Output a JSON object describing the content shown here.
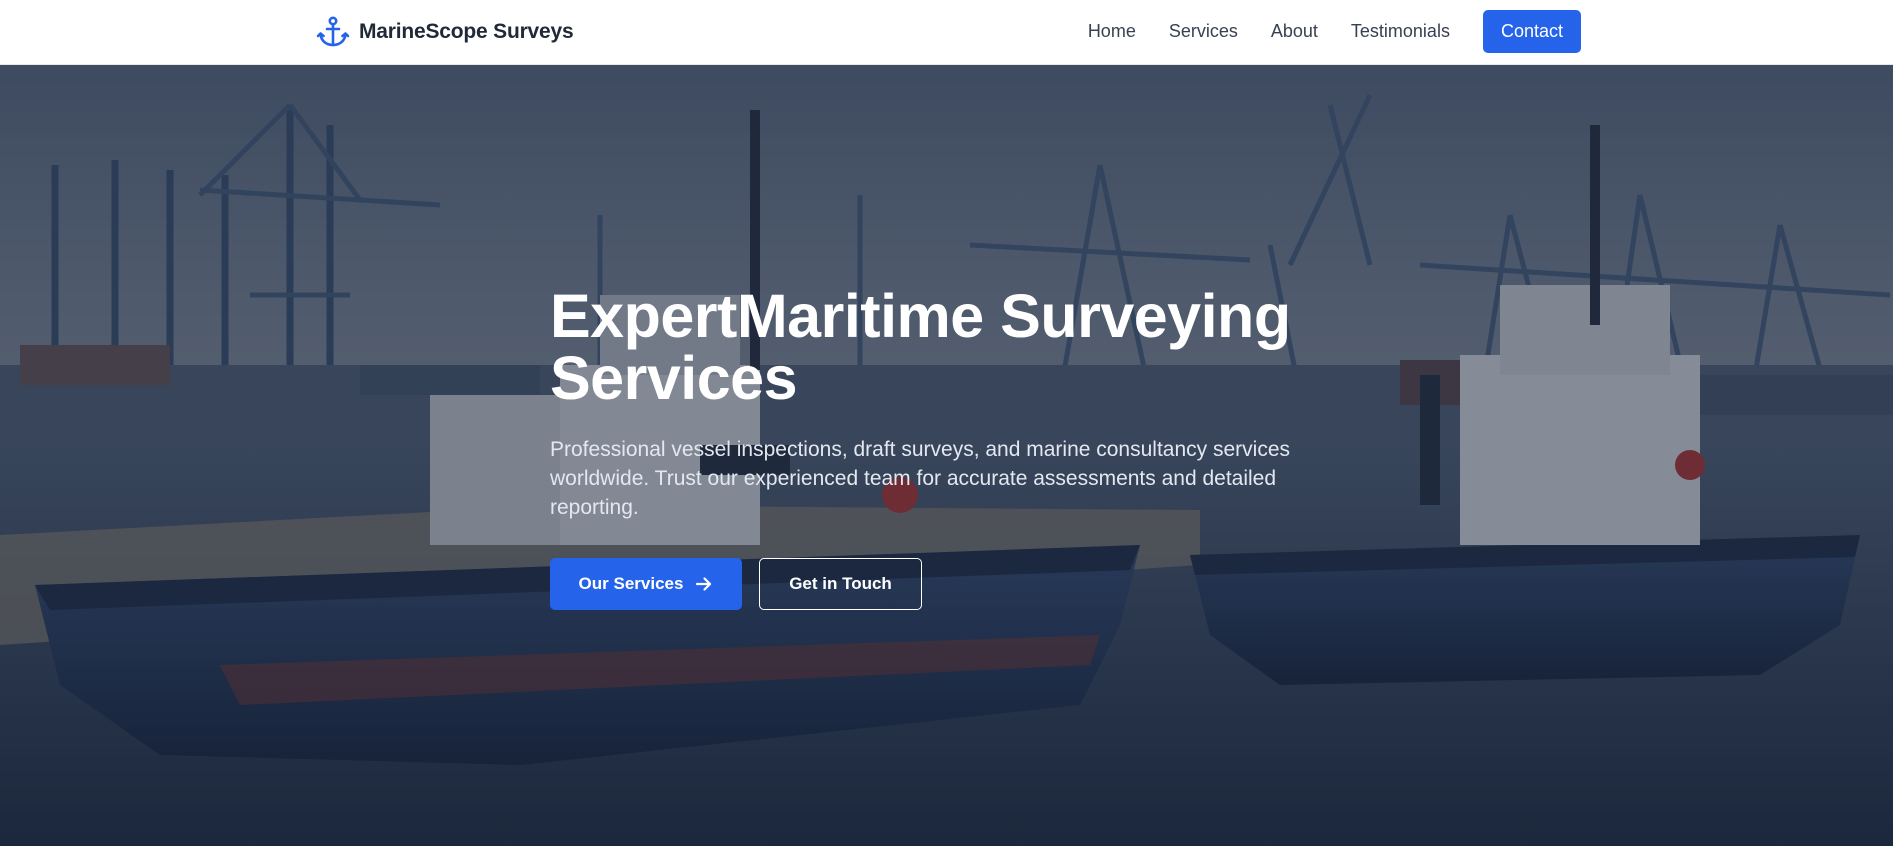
{
  "brand": {
    "name": "MarineScope Surveys",
    "icon": "anchor-icon",
    "accent": "#2563eb"
  },
  "nav": {
    "items": [
      {
        "label": "Home"
      },
      {
        "label": "Services"
      },
      {
        "label": "About"
      },
      {
        "label": "Testimonials"
      }
    ],
    "contact_label": "Contact"
  },
  "hero": {
    "title_line1": "ExpertMaritime Surveying",
    "title_line2": "Services",
    "subtitle": "Professional vessel inspections, draft surveys, and marine consultancy services worldwide. Trust our experienced team for accurate assessments and detailed reporting.",
    "primary_cta": "Our Services",
    "primary_cta_icon": "arrow-right-icon",
    "secondary_cta": "Get in Touch",
    "background": "harbor with cranes and two tugboats"
  }
}
